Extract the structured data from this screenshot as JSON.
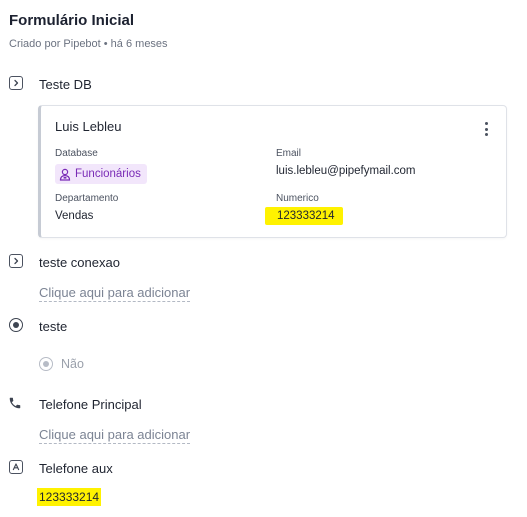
{
  "header": {
    "title": "Formulário Inicial",
    "subtitle": "Criado por Pipebot • há 6 meses"
  },
  "fields": {
    "teste_db": {
      "label": "Teste DB",
      "icon": "chevron-right-square-icon",
      "record": {
        "name": "Luis Lebleu",
        "database_label": "Database",
        "database_value": "Funcionários",
        "database_icon": "user-badge-icon",
        "email_label": "Email",
        "email_value": "luis.lebleu@pipefymail.com",
        "departamento_label": "Departamento",
        "departamento_value": "Vendas",
        "numerico_label": "Numerico",
        "numerico_value": "123333214"
      }
    },
    "teste_conexao": {
      "label": "teste conexao",
      "icon": "chevron-right-square-icon",
      "add_text": "Clique aqui para adicionar"
    },
    "teste": {
      "label": "teste",
      "icon": "radio-icon",
      "option": "Não"
    },
    "telefone_principal": {
      "label": "Telefone Principal",
      "icon": "phone-icon",
      "add_text": "Clique aqui para adicionar"
    },
    "telefone_aux": {
      "label": "Telefone aux",
      "icon": "text-a-square-icon",
      "value": "123333214"
    }
  },
  "colors": {
    "highlight": "#fff200",
    "badge_bg": "#f2e6fb",
    "badge_text": "#7a2bb6"
  }
}
